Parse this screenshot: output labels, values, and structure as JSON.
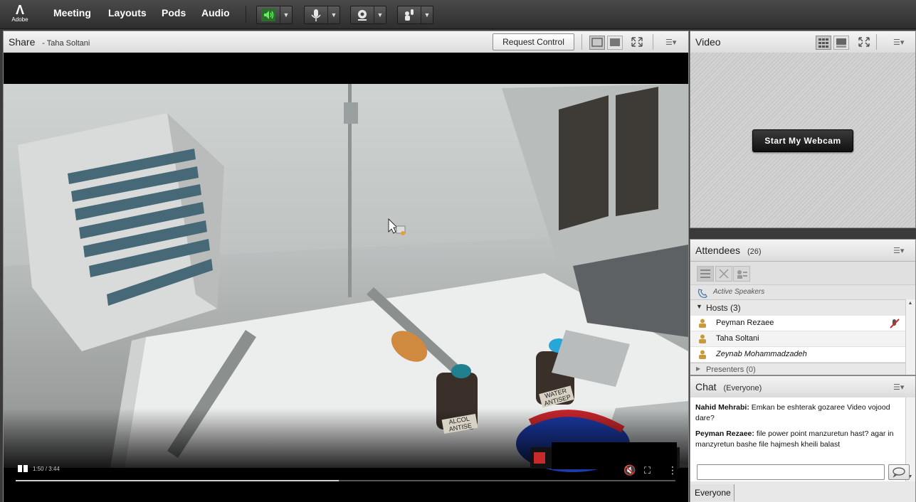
{
  "app": {
    "logo_text": "Adobe"
  },
  "menu": [
    "Meeting",
    "Layouts",
    "Pods",
    "Audio"
  ],
  "toolbar": {
    "speaker_icon": "speaker-icon",
    "mic_icon": "microphone-icon",
    "camera_icon": "webcam-icon",
    "raise_hand_icon": "raise-hand-icon"
  },
  "share": {
    "title": "Share",
    "presenter": "- Taha Soltani",
    "request_control": "Request Control",
    "player": {
      "time": "1:50 / 3:44",
      "progress_fraction": 0.49
    },
    "scene_labels": {
      "bottle1": "ALCOL ANTISE",
      "bottle2": "WATER ANTISEP"
    }
  },
  "video": {
    "title": "Video",
    "start_webcam": "Start My Webcam"
  },
  "attendees": {
    "title": "Attendees",
    "count": "(26)",
    "active_speakers": "Active Speakers",
    "hosts_label": "Hosts (3)",
    "hosts": [
      "Peyman Rezaee",
      "Taha Soltani",
      "Zeynab Mohammadzadeh"
    ],
    "presenters_label": "Presenters (0)"
  },
  "chat": {
    "title": "Chat",
    "scope": "(Everyone)",
    "messages": [
      {
        "sender": "Nahid Mehrabi:",
        "text": "Emkan be eshterak gozaree Video vojood dare?"
      },
      {
        "sender": "Peyman Rezaee:",
        "text": "file power point manzuretun hast? agar in manzyretun bashe file hajmesh kheili balast"
      }
    ],
    "tab": "Everyone"
  },
  "colors": {
    "speaker_active": "#3cd13c",
    "accent_blue": "#2c9fd8"
  }
}
